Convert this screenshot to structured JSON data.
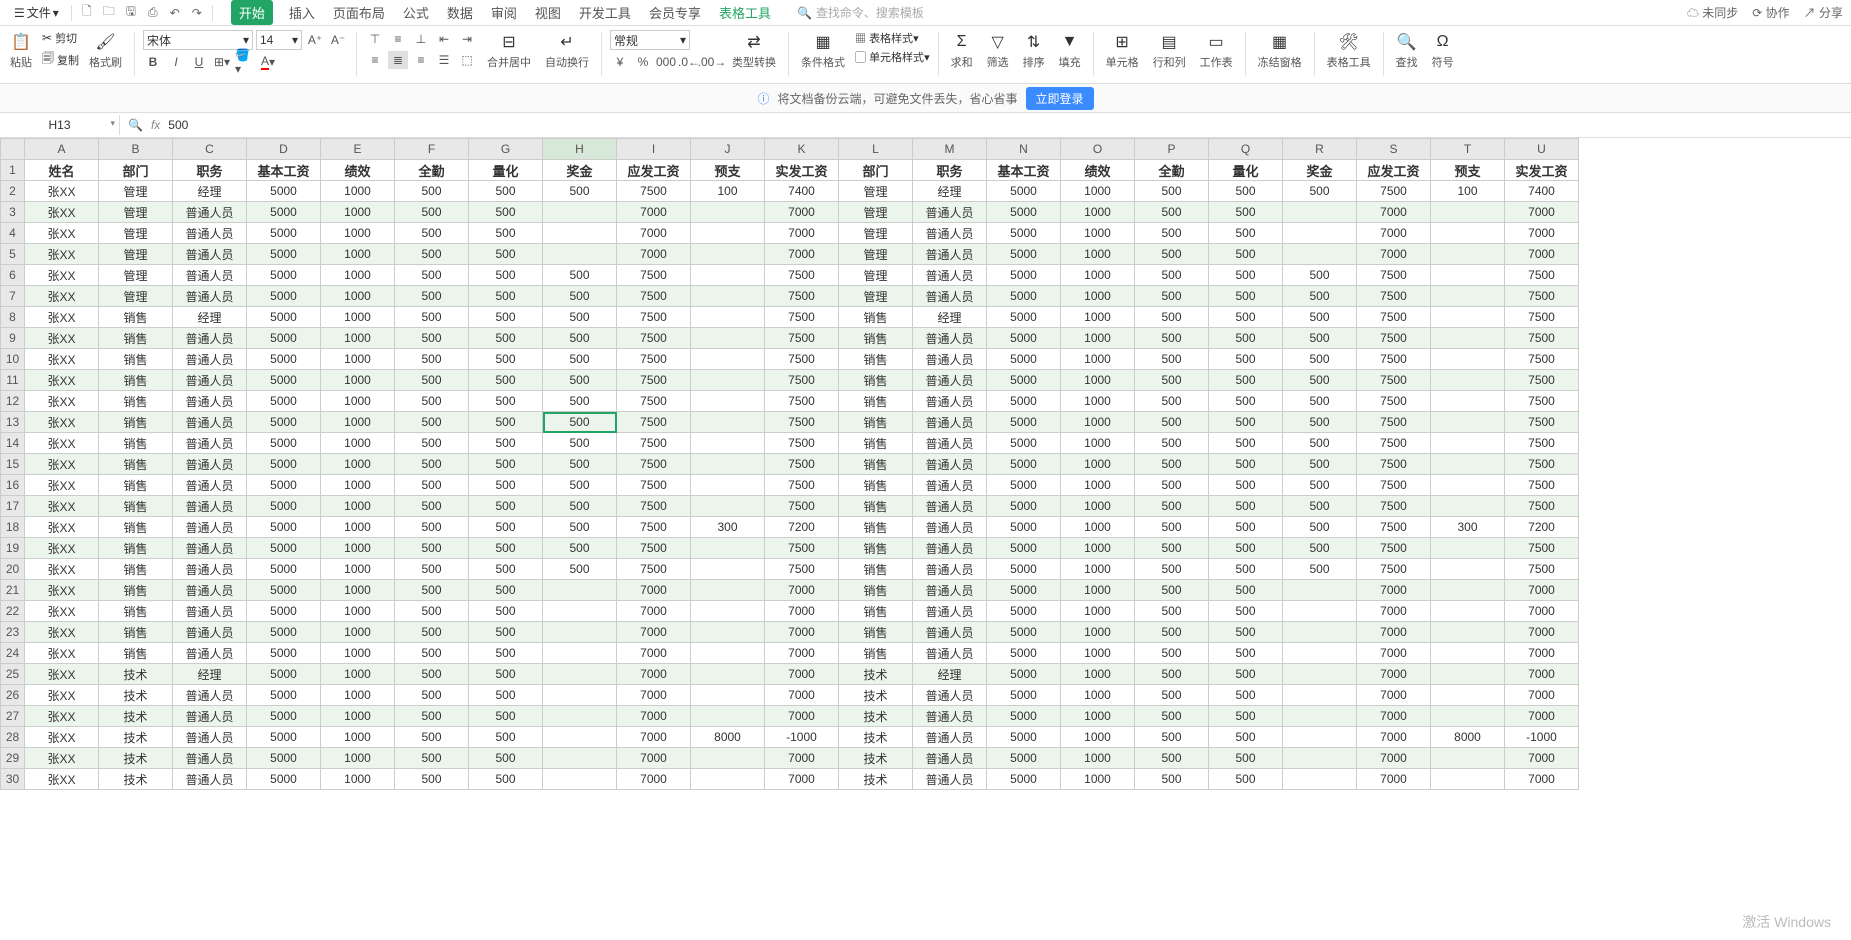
{
  "top": {
    "file_menu": "文件",
    "tabs": [
      "开始",
      "插入",
      "页面布局",
      "公式",
      "数据",
      "审阅",
      "视图",
      "开发工具",
      "会员专享",
      "表格工具"
    ],
    "active_tab": 0,
    "tool_tab_index": 9,
    "search_placeholder": "查找命令、搜索模板",
    "right": {
      "unsync": "未同步",
      "coop": "协作",
      "share": "分享"
    }
  },
  "ribbon": {
    "paste": "粘贴",
    "cut": "剪切",
    "copy": "复制",
    "format_painter": "格式刷",
    "font_name": "宋体",
    "font_size": "14",
    "merge": "合并居中",
    "wrap": "自动换行",
    "number_format": "常规",
    "type_convert": "类型转换",
    "cond_format": "条件格式",
    "table_style": "表格样式",
    "cell_style": "单元格样式",
    "sum": "求和",
    "filter": "筛选",
    "sort": "排序",
    "fill": "填充",
    "cell": "单元格",
    "rowcol": "行和列",
    "worksheet": "工作表",
    "freeze": "冻结窗格",
    "table_tool": "表格工具",
    "find": "查找",
    "symbol": "符号"
  },
  "notice": {
    "text": "将文档备份云端，可避免文件丢失，省心省事",
    "login": "立即登录"
  },
  "formula": {
    "cell_ref": "H13",
    "value": "500"
  },
  "columns": [
    "A",
    "B",
    "C",
    "D",
    "E",
    "F",
    "G",
    "H",
    "I",
    "J",
    "K",
    "L",
    "M",
    "N",
    "O",
    "P",
    "Q",
    "R",
    "S",
    "T",
    "U"
  ],
  "header_row": [
    "姓名",
    "部门",
    "职务",
    "基本工资",
    "绩效",
    "全勤",
    "量化",
    "奖金",
    "应发工资",
    "预支",
    "实发工资",
    "部门",
    "职务",
    "基本工资",
    "绩效",
    "全勤",
    "量化",
    "奖金",
    "应发工资",
    "预支",
    "实发工资"
  ],
  "rows": [
    [
      "张XX",
      "管理",
      "经理",
      "5000",
      "1000",
      "500",
      "500",
      "500",
      "7500",
      "100",
      "7400",
      "管理",
      "经理",
      "5000",
      "1000",
      "500",
      "500",
      "500",
      "7500",
      "100",
      "7400"
    ],
    [
      "张XX",
      "管理",
      "普通人员",
      "5000",
      "1000",
      "500",
      "500",
      "",
      "7000",
      "",
      "7000",
      "管理",
      "普通人员",
      "5000",
      "1000",
      "500",
      "500",
      "",
      "7000",
      "",
      "7000"
    ],
    [
      "张XX",
      "管理",
      "普通人员",
      "5000",
      "1000",
      "500",
      "500",
      "",
      "7000",
      "",
      "7000",
      "管理",
      "普通人员",
      "5000",
      "1000",
      "500",
      "500",
      "",
      "7000",
      "",
      "7000"
    ],
    [
      "张XX",
      "管理",
      "普通人员",
      "5000",
      "1000",
      "500",
      "500",
      "",
      "7000",
      "",
      "7000",
      "管理",
      "普通人员",
      "5000",
      "1000",
      "500",
      "500",
      "",
      "7000",
      "",
      "7000"
    ],
    [
      "张XX",
      "管理",
      "普通人员",
      "5000",
      "1000",
      "500",
      "500",
      "500",
      "7500",
      "",
      "7500",
      "管理",
      "普通人员",
      "5000",
      "1000",
      "500",
      "500",
      "500",
      "7500",
      "",
      "7500"
    ],
    [
      "张XX",
      "管理",
      "普通人员",
      "5000",
      "1000",
      "500",
      "500",
      "500",
      "7500",
      "",
      "7500",
      "管理",
      "普通人员",
      "5000",
      "1000",
      "500",
      "500",
      "500",
      "7500",
      "",
      "7500"
    ],
    [
      "张XX",
      "销售",
      "经理",
      "5000",
      "1000",
      "500",
      "500",
      "500",
      "7500",
      "",
      "7500",
      "销售",
      "经理",
      "5000",
      "1000",
      "500",
      "500",
      "500",
      "7500",
      "",
      "7500"
    ],
    [
      "张XX",
      "销售",
      "普通人员",
      "5000",
      "1000",
      "500",
      "500",
      "500",
      "7500",
      "",
      "7500",
      "销售",
      "普通人员",
      "5000",
      "1000",
      "500",
      "500",
      "500",
      "7500",
      "",
      "7500"
    ],
    [
      "张XX",
      "销售",
      "普通人员",
      "5000",
      "1000",
      "500",
      "500",
      "500",
      "7500",
      "",
      "7500",
      "销售",
      "普通人员",
      "5000",
      "1000",
      "500",
      "500",
      "500",
      "7500",
      "",
      "7500"
    ],
    [
      "张XX",
      "销售",
      "普通人员",
      "5000",
      "1000",
      "500",
      "500",
      "500",
      "7500",
      "",
      "7500",
      "销售",
      "普通人员",
      "5000",
      "1000",
      "500",
      "500",
      "500",
      "7500",
      "",
      "7500"
    ],
    [
      "张XX",
      "销售",
      "普通人员",
      "5000",
      "1000",
      "500",
      "500",
      "500",
      "7500",
      "",
      "7500",
      "销售",
      "普通人员",
      "5000",
      "1000",
      "500",
      "500",
      "500",
      "7500",
      "",
      "7500"
    ],
    [
      "张XX",
      "销售",
      "普通人员",
      "5000",
      "1000",
      "500",
      "500",
      "500",
      "7500",
      "",
      "7500",
      "销售",
      "普通人员",
      "5000",
      "1000",
      "500",
      "500",
      "500",
      "7500",
      "",
      "7500"
    ],
    [
      "张XX",
      "销售",
      "普通人员",
      "5000",
      "1000",
      "500",
      "500",
      "500",
      "7500",
      "",
      "7500",
      "销售",
      "普通人员",
      "5000",
      "1000",
      "500",
      "500",
      "500",
      "7500",
      "",
      "7500"
    ],
    [
      "张XX",
      "销售",
      "普通人员",
      "5000",
      "1000",
      "500",
      "500",
      "500",
      "7500",
      "",
      "7500",
      "销售",
      "普通人员",
      "5000",
      "1000",
      "500",
      "500",
      "500",
      "7500",
      "",
      "7500"
    ],
    [
      "张XX",
      "销售",
      "普通人员",
      "5000",
      "1000",
      "500",
      "500",
      "500",
      "7500",
      "",
      "7500",
      "销售",
      "普通人员",
      "5000",
      "1000",
      "500",
      "500",
      "500",
      "7500",
      "",
      "7500"
    ],
    [
      "张XX",
      "销售",
      "普通人员",
      "5000",
      "1000",
      "500",
      "500",
      "500",
      "7500",
      "",
      "7500",
      "销售",
      "普通人员",
      "5000",
      "1000",
      "500",
      "500",
      "500",
      "7500",
      "",
      "7500"
    ],
    [
      "张XX",
      "销售",
      "普通人员",
      "5000",
      "1000",
      "500",
      "500",
      "500",
      "7500",
      "300",
      "7200",
      "销售",
      "普通人员",
      "5000",
      "1000",
      "500",
      "500",
      "500",
      "7500",
      "300",
      "7200"
    ],
    [
      "张XX",
      "销售",
      "普通人员",
      "5000",
      "1000",
      "500",
      "500",
      "500",
      "7500",
      "",
      "7500",
      "销售",
      "普通人员",
      "5000",
      "1000",
      "500",
      "500",
      "500",
      "7500",
      "",
      "7500"
    ],
    [
      "张XX",
      "销售",
      "普通人员",
      "5000",
      "1000",
      "500",
      "500",
      "500",
      "7500",
      "",
      "7500",
      "销售",
      "普通人员",
      "5000",
      "1000",
      "500",
      "500",
      "500",
      "7500",
      "",
      "7500"
    ],
    [
      "张XX",
      "销售",
      "普通人员",
      "5000",
      "1000",
      "500",
      "500",
      "",
      "7000",
      "",
      "7000",
      "销售",
      "普通人员",
      "5000",
      "1000",
      "500",
      "500",
      "",
      "7000",
      "",
      "7000"
    ],
    [
      "张XX",
      "销售",
      "普通人员",
      "5000",
      "1000",
      "500",
      "500",
      "",
      "7000",
      "",
      "7000",
      "销售",
      "普通人员",
      "5000",
      "1000",
      "500",
      "500",
      "",
      "7000",
      "",
      "7000"
    ],
    [
      "张XX",
      "销售",
      "普通人员",
      "5000",
      "1000",
      "500",
      "500",
      "",
      "7000",
      "",
      "7000",
      "销售",
      "普通人员",
      "5000",
      "1000",
      "500",
      "500",
      "",
      "7000",
      "",
      "7000"
    ],
    [
      "张XX",
      "销售",
      "普通人员",
      "5000",
      "1000",
      "500",
      "500",
      "",
      "7000",
      "",
      "7000",
      "销售",
      "普通人员",
      "5000",
      "1000",
      "500",
      "500",
      "",
      "7000",
      "",
      "7000"
    ],
    [
      "张XX",
      "技术",
      "经理",
      "5000",
      "1000",
      "500",
      "500",
      "",
      "7000",
      "",
      "7000",
      "技术",
      "经理",
      "5000",
      "1000",
      "500",
      "500",
      "",
      "7000",
      "",
      "7000"
    ],
    [
      "张XX",
      "技术",
      "普通人员",
      "5000",
      "1000",
      "500",
      "500",
      "",
      "7000",
      "",
      "7000",
      "技术",
      "普通人员",
      "5000",
      "1000",
      "500",
      "500",
      "",
      "7000",
      "",
      "7000"
    ],
    [
      "张XX",
      "技术",
      "普通人员",
      "5000",
      "1000",
      "500",
      "500",
      "",
      "7000",
      "",
      "7000",
      "技术",
      "普通人员",
      "5000",
      "1000",
      "500",
      "500",
      "",
      "7000",
      "",
      "7000"
    ],
    [
      "张XX",
      "技术",
      "普通人员",
      "5000",
      "1000",
      "500",
      "500",
      "",
      "7000",
      "8000",
      "-1000",
      "技术",
      "普通人员",
      "5000",
      "1000",
      "500",
      "500",
      "",
      "7000",
      "8000",
      "-1000"
    ],
    [
      "张XX",
      "技术",
      "普通人员",
      "5000",
      "1000",
      "500",
      "500",
      "",
      "7000",
      "",
      "7000",
      "技术",
      "普通人员",
      "5000",
      "1000",
      "500",
      "500",
      "",
      "7000",
      "",
      "7000"
    ],
    [
      "张XX",
      "技术",
      "普通人员",
      "5000",
      "1000",
      "500",
      "500",
      "",
      "7000",
      "",
      "7000",
      "技术",
      "普通人员",
      "5000",
      "1000",
      "500",
      "500",
      "",
      "7000",
      "",
      "7000"
    ]
  ],
  "active_cell": {
    "row": 13,
    "col": "H"
  },
  "watermark": "激活 Windows"
}
